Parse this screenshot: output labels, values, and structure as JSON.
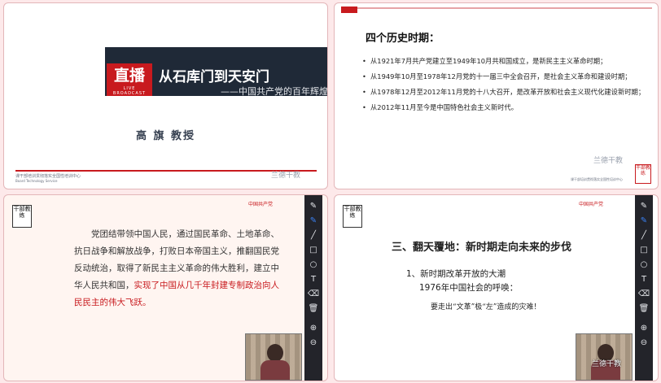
{
  "panel1": {
    "badge_main": "直播",
    "badge_sub": "LIVE BROADCAST",
    "title": "从石库门到天安门",
    "subtitle": "——中国共产党的百年辉煌",
    "presenter": "高 旗 教授",
    "footer_cn": "课干部培训贯彻落实全国性培训中心",
    "footer_en": "Board Technology Service",
    "watermark": "兰德干教"
  },
  "panel2": {
    "heading": "四个历史时期：",
    "periods": [
      "从1921年7月共产党建立至1949年10月共和国成立，是新民主主义革命时期；",
      "从1949年10月至1978年12月党的十一届三中全会召开，是社会主义革命和建设时期；",
      "从1978年12月至2012年11月党的十八大召开，是改革开放和社会主义现代化建设新时期；",
      "从2012年11月至今是中国特色社会主义新时代。"
    ],
    "footer": "课干部培训贯彻落实全国性培训中心",
    "logo": "干部教练",
    "watermark": "兰德干教"
  },
  "panel3": {
    "cpc_label": "中国共产党",
    "seal": "干部教练",
    "text_normal": "党团结带领中国人民，通过国民革命、土地革命、抗日战争和解放战争，打败日本帝国主义，推翻国民党反动统治，取得了新民主主义革命的伟大胜利，建立中华人民共和国，",
    "text_red": "实现了中国从几千年封建专制政治向人民民主的伟大飞跃。"
  },
  "panel4": {
    "cpc_label": "中国共产党",
    "seal": "干部教练",
    "heading": "三、翻天覆地：新时期走向未来的步伐",
    "item": "1、新时期改革开放的大潮",
    "item_sub": "1976年中国社会的呼唤：",
    "quote": "要走出“文革”极“左”造成的灾难！",
    "watermark": "兰德干教"
  },
  "toolbar": [
    "pen-icon",
    "brush-icon",
    "line-icon",
    "rectangle-icon",
    "circle-icon",
    "text-icon",
    "eraser-icon",
    "trash-icon",
    "zoom-in-icon",
    "zoom-out-icon"
  ],
  "toolbar_glyphs": [
    "✎",
    "✎",
    "╱",
    "□",
    "○",
    "T",
    "⌫",
    "🗑",
    "⊕",
    "⊖"
  ],
  "colors": {
    "accent_red": "#c81a1e",
    "background": "#fde9ea",
    "toolbar": "#23242a"
  }
}
